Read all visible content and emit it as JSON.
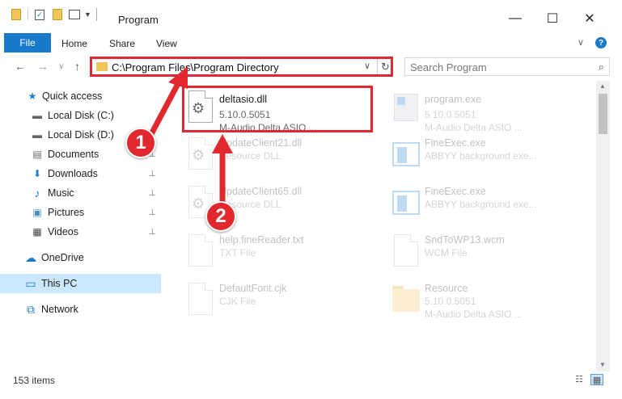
{
  "window": {
    "title": "Program",
    "minimize_glyph": "—",
    "maximize_glyph": "☐",
    "close_glyph": "✕"
  },
  "ribbon": {
    "tabs": [
      "File",
      "Home",
      "Share",
      "View"
    ],
    "collapse_glyph": "∨",
    "help_glyph": "?"
  },
  "nav": {
    "back_glyph": "←",
    "forward_glyph": "→",
    "recent_glyph": "∨",
    "up_glyph": "↑",
    "address": "C:\\Program Files\\Program Directory",
    "address_dropdown_glyph": "∨",
    "refresh_glyph": "↻",
    "search_placeholder": "Search Program",
    "search_glyph": "⌕"
  },
  "sidebar": {
    "items": [
      {
        "label": "Quick access",
        "icon": "star-icon",
        "glyph": "★",
        "pinned": false
      },
      {
        "label": "Local Disk (C:)",
        "icon": "drive-icon",
        "glyph": "▬",
        "pinned": false
      },
      {
        "label": "Local Disk (D:)",
        "icon": "drive-icon",
        "glyph": "▬",
        "pinned": false
      },
      {
        "label": "Documents",
        "icon": "documents-icon",
        "glyph": "▤",
        "pinned": true
      },
      {
        "label": "Downloads",
        "icon": "downloads-icon",
        "glyph": "⬇",
        "pinned": true
      },
      {
        "label": "Music",
        "icon": "music-icon",
        "glyph": "♪",
        "pinned": true
      },
      {
        "label": "Pictures",
        "icon": "pictures-icon",
        "glyph": "▣",
        "pinned": true
      },
      {
        "label": "Videos",
        "icon": "videos-icon",
        "glyph": "▦",
        "pinned": true
      },
      {
        "label": "OneDrive",
        "icon": "onedrive-icon",
        "glyph": "☁",
        "pinned": false
      },
      {
        "label": "This PC",
        "icon": "pc-icon",
        "glyph": "▭",
        "pinned": false
      },
      {
        "label": "Network",
        "icon": "network-icon",
        "glyph": "⧉",
        "pinned": false
      }
    ],
    "pin_glyph": "📌"
  },
  "files": [
    {
      "name": "deltasio.dll",
      "line2": "5.10.0.5051",
      "line3": "M-Audio Delta ASIO ...",
      "icon": "dll-gear-icon",
      "faded": false
    },
    {
      "name": "program.exe",
      "line2": "5.10.0.5051",
      "line3": "M-Audio Delta ASIO ...",
      "icon": "exe-icon",
      "faded": true
    },
    {
      "name": "UpdateClient21.dll",
      "line2": "Resource DLL",
      "line3": "",
      "icon": "dll-gear-icon",
      "faded": true
    },
    {
      "name": "FineExec.exe",
      "line2": "ABBYY background exe...",
      "line3": "",
      "icon": "app-icon",
      "faded": true
    },
    {
      "name": "UpdateClient65.dll",
      "line2": "Resource DLL",
      "line3": "",
      "icon": "dll-gear-icon",
      "faded": true
    },
    {
      "name": "FineExec.exe",
      "line2": "ABBYY background exe...",
      "line3": "",
      "icon": "app-icon",
      "faded": true
    },
    {
      "name": "help.fineReader.txt",
      "line2": "TXT File",
      "line3": "",
      "icon": "text-file-icon",
      "faded": true
    },
    {
      "name": "SndToWP13.wcm",
      "line2": "WCM File",
      "line3": "",
      "icon": "text-file-icon",
      "faded": true
    },
    {
      "name": "DefaultFont.cjk",
      "line2": "CJK File",
      "line3": "",
      "icon": "text-file-icon",
      "faded": true
    },
    {
      "name": "Resource",
      "line2": "5.10.0.5051",
      "line3": "M-Audio Delta ASIO ...",
      "icon": "folder-icon",
      "faded": true
    }
  ],
  "status": {
    "item_count": "153 items",
    "details_view_glyph": "☷",
    "tiles_view_glyph": "▦"
  },
  "callouts": [
    "1",
    "2"
  ],
  "colors": {
    "accent": "#1979ca",
    "highlight_red": "#e0282e",
    "selected_bg": "#cce8ff",
    "folder": "#f2c55c"
  }
}
